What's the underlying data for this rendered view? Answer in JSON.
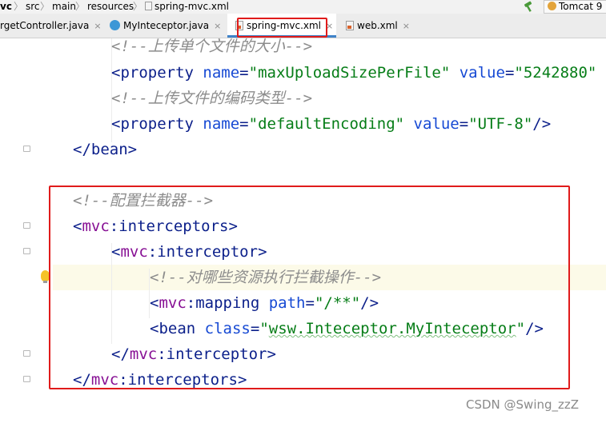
{
  "breadcrumb": {
    "items": [
      "vc",
      "src",
      "main",
      "resources",
      "spring-mvc.xml"
    ],
    "separator": "〉"
  },
  "run_config": {
    "hammer_icon": "hammer-icon",
    "label": "Tomcat 9"
  },
  "tabs": [
    {
      "label": "rgetController.java",
      "icon": "java-class-icon",
      "active": false
    },
    {
      "label": "MyInteceptor.java",
      "icon": "java-class-icon",
      "active": false
    },
    {
      "label": "spring-mvc.xml",
      "icon": "xml-file-icon",
      "active": true
    },
    {
      "label": "web.xml",
      "icon": "xml-file-icon",
      "active": false
    }
  ],
  "tab_close_glyph": "×",
  "code": {
    "l1_comment": "<!--上传单个文件的大小-->",
    "l2_open": "<",
    "l2_tag": "property",
    "l2_attr1": " name",
    "l2_eq1": "=",
    "l2_val1": "\"maxUploadSizePerFile\"",
    "l2_attr2": " value",
    "l2_eq2": "=",
    "l2_val2": "\"5242880\"",
    "l3_comment": "<!--上传文件的编码类型-->",
    "l4_open": "<",
    "l4_tag": "property",
    "l4_attr1": " name",
    "l4_eq1": "=",
    "l4_val1": "\"defaultEncoding\"",
    "l4_attr2": " value",
    "l4_eq2": "=",
    "l4_val2": "\"UTF-8\"",
    "l4_close": "/>",
    "l5_open": "</",
    "l5_tag": "bean",
    "l5_close": ">",
    "l6_comment": "<!--配置拦截器-->",
    "l7_open": "<",
    "l7_ns": "mvc",
    "l7_tag": ":interceptors",
    "l7_close": ">",
    "l8_open": "<",
    "l8_ns": "mvc",
    "l8_tag": ":interceptor",
    "l8_close": ">",
    "l9_comment": "<!--对哪些资源执行拦截操作-->",
    "l10_open": "<",
    "l10_ns": "mvc",
    "l10_tag": ":mapping",
    "l10_attr": " path",
    "l10_eq": "=",
    "l10_val": "\"/**\"",
    "l10_close": "/>",
    "l11_open": "<",
    "l11_tag": "bean",
    "l11_attr": " class",
    "l11_eq": "=",
    "l11_val_q1": "\"",
    "l11_val": "wsw.Inteceptor.MyInteceptor",
    "l11_val_q2": "\"",
    "l11_close": "/>",
    "l12_open": "</",
    "l12_ns": "mvc",
    "l12_tag": ":interceptor",
    "l12_close": ">",
    "l13_open": "</",
    "l13_ns": "mvc",
    "l13_tag": ":interceptors",
    "l13_close": ">"
  },
  "watermark": "CSDN @Swing_zzZ",
  "colors": {
    "annotation_box": "#e01b1b",
    "tag": "#0b1f8a",
    "namespace": "#871094",
    "attribute": "#174ad4",
    "attribute_value": "#067d17",
    "comment": "#8c8c8c",
    "active_tab_underline": "#4083c9",
    "caret_line": "#fcfae8"
  }
}
